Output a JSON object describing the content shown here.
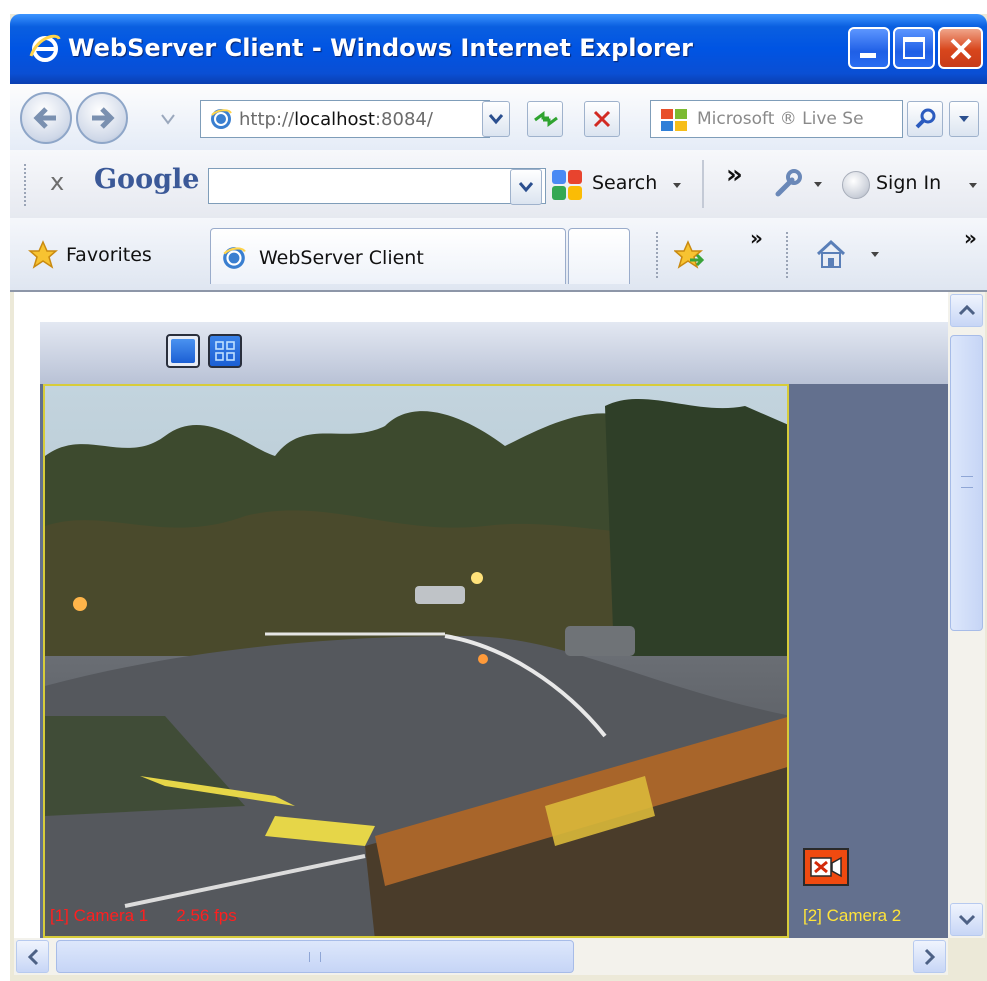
{
  "window": {
    "title": "WebServer Client - Windows Internet Explorer"
  },
  "navbar": {
    "address": {
      "prefix": "http://",
      "host": "localhost",
      "port": ":8084/"
    },
    "live_search_placeholder": "Microsoft ® Live Se"
  },
  "googlebar": {
    "close_glyph": "x",
    "brand": "Google",
    "search_value": "",
    "search_label": "Search",
    "more_glyph": "»",
    "sign_in_label": "Sign In"
  },
  "favbar": {
    "favorites_label": "Favorites",
    "tab_title": "WebServer Client",
    "more_glyph": "»"
  },
  "viewer": {
    "cameras": [
      {
        "label": "[1] Camera 1",
        "fps": "2.56 fps"
      },
      {
        "label": "[2] Camera 2"
      }
    ]
  },
  "colors": {
    "titlebar": "#0054e3",
    "camera1_label": "#ff1f1f",
    "camera2_label": "#ffe43a",
    "panel_bg": "#63708e",
    "nocamera_icon": "#f04a10"
  },
  "icons": {
    "title": "ie-logo-icon",
    "back": "back-arrow-icon",
    "forward": "forward-arrow-icon",
    "refresh": "refresh-icon",
    "stop": "stop-icon",
    "search": "magnifier-icon",
    "favorites": "star-icon",
    "home": "home-icon",
    "tools": "wrench-icon",
    "layout_single": "single-view-icon",
    "layout_grid": "grid-view-icon",
    "no_camera": "camera-off-icon"
  }
}
